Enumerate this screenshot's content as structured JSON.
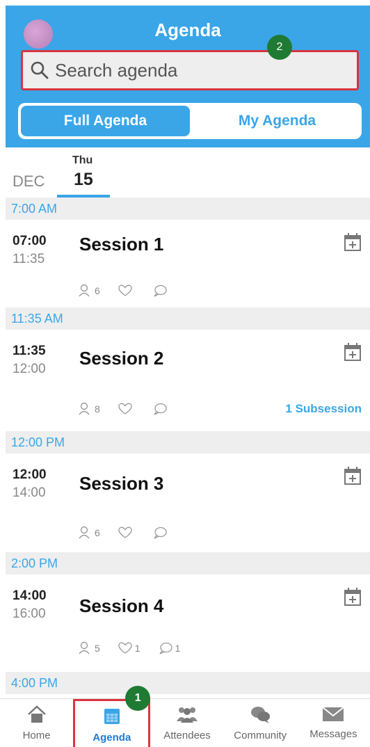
{
  "header": {
    "title": "Agenda",
    "search_placeholder": "Search agenda",
    "tabs": [
      {
        "label": "Full Agenda",
        "active": true
      },
      {
        "label": "My Agenda",
        "active": false
      }
    ],
    "accent_color": "#3aa6e8"
  },
  "markers": {
    "one": "1",
    "two": "2"
  },
  "date_bar": {
    "month": "DEC",
    "day_of_week": "Thu",
    "day_number": "15"
  },
  "agenda": [
    {
      "time_header": "7:00 AM",
      "start": "07:00",
      "end": "11:35",
      "title": "Session 1",
      "attendees": "6",
      "likes": "",
      "comments": "",
      "subsessions": ""
    },
    {
      "time_header": "11:35 AM",
      "start": "11:35",
      "end": "12:00",
      "title": "Session 2",
      "attendees": "8",
      "likes": "",
      "comments": "",
      "subsessions": "1 Subsession"
    },
    {
      "time_header": "12:00 PM",
      "start": "12:00",
      "end": "14:00",
      "title": "Session 3",
      "attendees": "6",
      "likes": "",
      "comments": "",
      "subsessions": ""
    },
    {
      "time_header": "2:00 PM",
      "start": "14:00",
      "end": "16:00",
      "title": "Session 4",
      "attendees": "5",
      "likes": "1",
      "comments": "1",
      "subsessions": ""
    }
  ],
  "next_time_header": "4:00 PM",
  "nav": {
    "items": [
      {
        "label": "Home",
        "icon": "home-icon",
        "active": false
      },
      {
        "label": "Agenda",
        "icon": "calendar-icon",
        "active": true
      },
      {
        "label": "Attendees",
        "icon": "people-icon",
        "active": false
      },
      {
        "label": "Community",
        "icon": "chat-bubbles-icon",
        "active": false
      },
      {
        "label": "Messages",
        "icon": "envelope-icon",
        "active": false
      }
    ]
  }
}
